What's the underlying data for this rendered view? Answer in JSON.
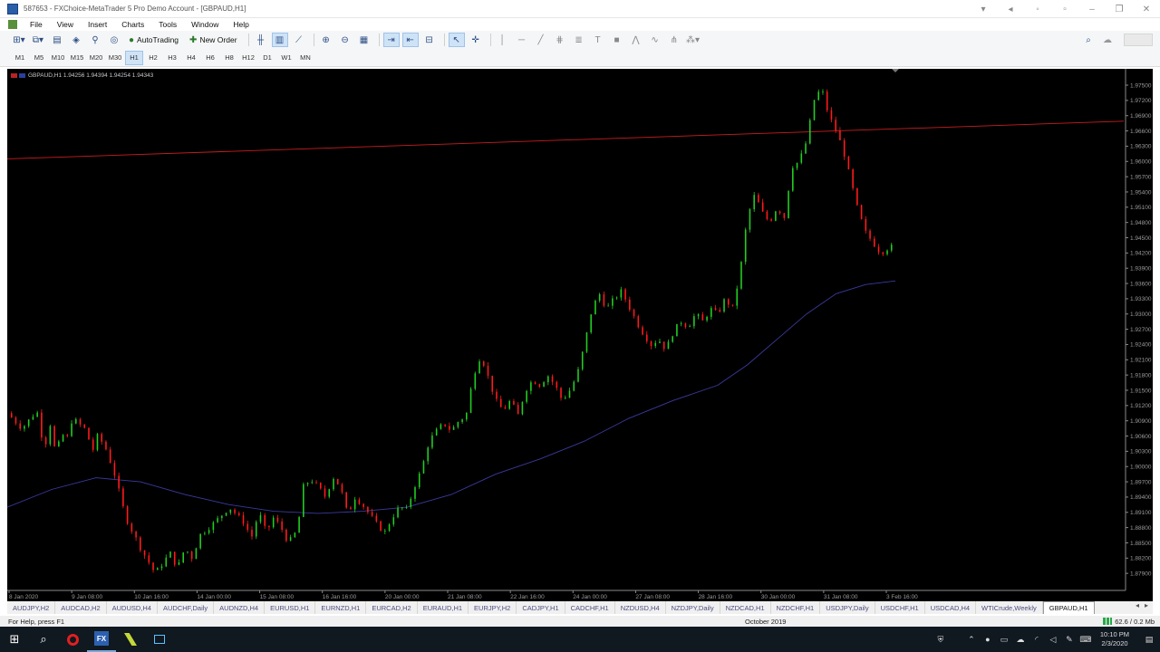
{
  "window": {
    "title": "587653 - FXChoice-MetaTrader 5 Pro Demo Account - [GBPAUD,H1]"
  },
  "menu": [
    "File",
    "View",
    "Insert",
    "Charts",
    "Tools",
    "Window",
    "Help"
  ],
  "toolbar": {
    "autotrading_label": "AutoTrading",
    "new_order_label": "New Order"
  },
  "timeframes": [
    "M1",
    "M5",
    "M10",
    "M15",
    "M20",
    "M30",
    "H1",
    "H2",
    "H3",
    "H4",
    "H6",
    "H8",
    "H12",
    "D1",
    "W1",
    "MN"
  ],
  "active_timeframe": "H1",
  "chart": {
    "info": "GBPAUD,H1  1.94256 1.94394 1.94254 1.94343",
    "colors": {
      "bull": "#22cc22",
      "bear": "#ff1a1a",
      "ma": "#3a3aa0",
      "trend": "#c81e1e",
      "axis_text": "#9a9a9a"
    }
  },
  "chart_data": {
    "type": "candlestick",
    "symbol": "GBPAUD",
    "timeframe": "H1",
    "ylim": [
      1.876,
      1.9775
    ],
    "price_ticks": [
      "1.97500",
      "1.97200",
      "1.96900",
      "1.96600",
      "1.96300",
      "1.96000",
      "1.95700",
      "1.95400",
      "1.95100",
      "1.94800",
      "1.94500",
      "1.94200",
      "1.93900",
      "1.93600",
      "1.93300",
      "1.93000",
      "1.92700",
      "1.92400",
      "1.92100",
      "1.91800",
      "1.91500",
      "1.91200",
      "1.90900",
      "1.90600",
      "1.90300",
      "1.90000",
      "1.89700",
      "1.89400",
      "1.89100",
      "1.88800",
      "1.88500",
      "1.88200",
      "1.87900"
    ],
    "time_ticks": [
      "8 Jan 2020",
      "9 Jan 08:00",
      "10 Jan 16:00",
      "14 Jan 00:00",
      "15 Jan 08:00",
      "16 Jan 16:00",
      "20 Jan 00:00",
      "21 Jan 08:00",
      "22 Jan 16:00",
      "24 Jan 00:00",
      "27 Jan 08:00",
      "28 Jan 16:00",
      "30 Jan 00:00",
      "31 Jan 08:00",
      "3 Feb 16:00"
    ],
    "close_path": [
      [
        0,
        1.9105
      ],
      [
        10,
        1.9075
      ],
      [
        20,
        1.911
      ],
      [
        25,
        1.9035
      ],
      [
        30,
        1.9095
      ],
      [
        33,
        1.9005
      ],
      [
        36,
        1.907
      ],
      [
        40,
        1.905
      ],
      [
        44,
        1.9095
      ],
      [
        50,
        1.908
      ],
      [
        54,
        1.907
      ],
      [
        57,
        1.9025
      ],
      [
        61,
        1.906
      ],
      [
        66,
        1.904
      ],
      [
        72,
        1.899
      ],
      [
        76,
        1.8945
      ],
      [
        80,
        1.89
      ],
      [
        85,
        1.887
      ],
      [
        90,
        1.884
      ],
      [
        95,
        1.8815
      ],
      [
        100,
        1.879
      ],
      [
        105,
        1.881
      ],
      [
        110,
        1.883
      ],
      [
        115,
        1.88
      ],
      [
        120,
        1.884
      ],
      [
        125,
        1.882
      ],
      [
        130,
        1.8865
      ],
      [
        140,
        1.889
      ],
      [
        150,
        1.892
      ],
      [
        160,
        1.889
      ],
      [
        165,
        1.886
      ],
      [
        170,
        1.891
      ],
      [
        175,
        1.887
      ],
      [
        180,
        1.89
      ],
      [
        185,
        1.888
      ],
      [
        190,
        1.885
      ],
      [
        196,
        1.8875
      ],
      [
        200,
        1.896
      ],
      [
        205,
        1.8975
      ],
      [
        210,
        1.896
      ],
      [
        215,
        1.894
      ],
      [
        220,
        1.898
      ],
      [
        225,
        1.896
      ],
      [
        230,
        1.8905
      ],
      [
        235,
        1.894
      ],
      [
        240,
        1.8925
      ],
      [
        250,
        1.8885
      ],
      [
        255,
        1.887
      ],
      [
        260,
        1.89
      ],
      [
        265,
        1.892
      ],
      [
        270,
        1.8915
      ],
      [
        275,
        1.896
      ],
      [
        280,
        1.8995
      ],
      [
        285,
        1.905
      ],
      [
        290,
        1.907
      ],
      [
        295,
        1.9085
      ],
      [
        300,
        1.907
      ],
      [
        305,
        1.909
      ],
      [
        310,
        1.91
      ],
      [
        315,
        1.918
      ],
      [
        320,
        1.922
      ],
      [
        325,
        1.9175
      ],
      [
        330,
        1.913
      ],
      [
        335,
        1.911
      ],
      [
        340,
        1.913
      ],
      [
        345,
        1.91
      ],
      [
        350,
        1.915
      ],
      [
        355,
        1.917
      ],
      [
        360,
        1.916
      ],
      [
        365,
        1.918
      ],
      [
        370,
        1.916
      ],
      [
        375,
        1.913
      ],
      [
        380,
        1.915
      ],
      [
        385,
        1.918
      ],
      [
        390,
        1.924
      ],
      [
        395,
        1.931
      ],
      [
        400,
        1.934
      ],
      [
        405,
        1.931
      ],
      [
        410,
        1.933
      ],
      [
        415,
        1.9345
      ],
      [
        420,
        1.9315
      ],
      [
        425,
        1.9285
      ],
      [
        430,
        1.926
      ],
      [
        435,
        1.924
      ],
      [
        440,
        1.925
      ],
      [
        445,
        1.923
      ],
      [
        450,
        1.9265
      ],
      [
        455,
        1.9285
      ],
      [
        460,
        1.9275
      ],
      [
        465,
        1.93
      ],
      [
        470,
        1.9285
      ],
      [
        475,
        1.931
      ],
      [
        480,
        1.93
      ],
      [
        485,
        1.933
      ],
      [
        490,
        1.931
      ],
      [
        495,
        1.938
      ],
      [
        500,
        1.949
      ],
      [
        505,
        1.9535
      ],
      [
        510,
        1.95
      ],
      [
        515,
        1.948
      ],
      [
        520,
        1.951
      ],
      [
        525,
        1.949
      ],
      [
        530,
        1.959
      ],
      [
        535,
        1.96
      ],
      [
        540,
        1.964
      ],
      [
        545,
        1.972
      ],
      [
        550,
        1.9745
      ],
      [
        555,
        1.969
      ],
      [
        560,
        1.966
      ],
      [
        565,
        1.962
      ],
      [
        570,
        1.956
      ],
      [
        575,
        1.95
      ],
      [
        580,
        1.946
      ],
      [
        585,
        1.944
      ],
      [
        590,
        1.942
      ],
      [
        595,
        1.943
      ],
      [
        600,
        1.9434
      ]
    ],
    "ma_path": [
      [
        0,
        1.892
      ],
      [
        30,
        1.8955
      ],
      [
        60,
        1.8978
      ],
      [
        90,
        1.897
      ],
      [
        120,
        1.8945
      ],
      [
        150,
        1.8925
      ],
      [
        180,
        1.8912
      ],
      [
        210,
        1.8908
      ],
      [
        240,
        1.8912
      ],
      [
        270,
        1.892
      ],
      [
        300,
        1.8945
      ],
      [
        330,
        1.8985
      ],
      [
        360,
        1.9015
      ],
      [
        390,
        1.905
      ],
      [
        420,
        1.9095
      ],
      [
        450,
        1.913
      ],
      [
        480,
        1.916
      ],
      [
        500,
        1.92
      ],
      [
        520,
        1.925
      ],
      [
        540,
        1.93
      ],
      [
        560,
        1.934
      ],
      [
        580,
        1.9358
      ],
      [
        600,
        1.9365
      ]
    ],
    "trendline": [
      [
        0,
        1.9605
      ],
      [
        600,
        1.9664
      ]
    ],
    "x_domain": [
      0,
      600
    ]
  },
  "symbol_tabs": [
    "AUDJPY,H2",
    "AUDCAD,H2",
    "AUDUSD,H4",
    "AUDCHF,Daily",
    "AUDNZD,H4",
    "EURUSD,H1",
    "EURNZD,H1",
    "EURCAD,H2",
    "EURAUD,H1",
    "EURJPY,H2",
    "CADJPY,H1",
    "CADCHF,H1",
    "NZDUSD,H4",
    "NZDJPY,Daily",
    "NZDCAD,H1",
    "NZDCHF,H1",
    "USDJPY,Daily",
    "USDCHF,H1",
    "USDCAD,H4",
    "WTICrude,Weekly",
    "GBPAUD,H1"
  ],
  "active_symbol_tab": "GBPAUD,H1",
  "status": {
    "help": "For Help, press F1",
    "middle": "October 2019",
    "traffic": "62.6 / 0.2 Mb"
  },
  "taskbar": {
    "fx_label": "FX",
    "time": "10:10 PM",
    "date": "2/3/2020"
  }
}
